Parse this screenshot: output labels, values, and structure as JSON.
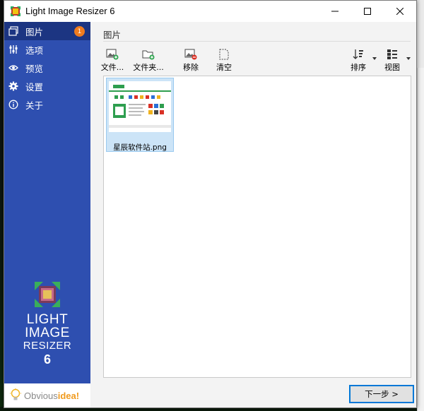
{
  "window": {
    "title": "Light Image Resizer 6"
  },
  "sidebar": {
    "items": [
      {
        "label": "图片",
        "icon": "images-icon",
        "active": true,
        "badge": "1"
      },
      {
        "label": "选项",
        "icon": "sliders-icon"
      },
      {
        "label": "预览",
        "icon": "eye-icon"
      },
      {
        "label": "设置",
        "icon": "gear-icon"
      },
      {
        "label": "关于",
        "icon": "info-icon"
      }
    ],
    "brand": {
      "line1": "LIGHT",
      "line2": "IMAGE",
      "line3": "RESIZER",
      "version": "6"
    },
    "footer": {
      "text_plain": "Obvious",
      "text_accent": "idea!"
    }
  },
  "main": {
    "section_title": "图片",
    "toolbar": {
      "add_files": "文件...",
      "add_folder": "文件夹...",
      "remove": "移除",
      "clear": "清空",
      "sort": "排序",
      "view": "视图"
    },
    "files": [
      {
        "name": "星辰软件站.png"
      }
    ],
    "next_button": "下一步 >"
  },
  "colors": {
    "sidebar": "#2e4fb0",
    "sidebar_active": "#1c3582",
    "badge": "#f07b1d",
    "selection": "#cce4f7",
    "accent": "#0078d7"
  }
}
